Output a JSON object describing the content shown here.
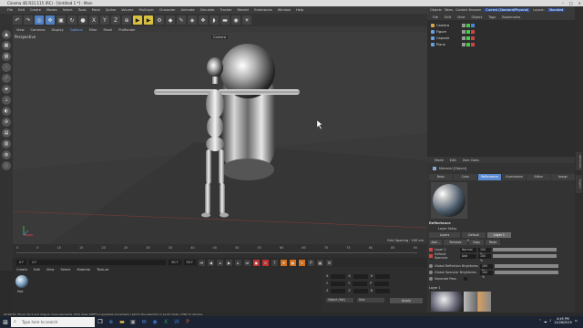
{
  "window": {
    "title": "Cinema 4D R21.115 (RC) - [Untitled 1 *] - Main",
    "controls": [
      "–",
      "□",
      "×"
    ]
  },
  "menu": [
    "File",
    "Edit",
    "Create",
    "Modes",
    "Select",
    "Tools",
    "Mesh",
    "Spline",
    "Volume",
    "MoGraph",
    "Character",
    "Animate",
    "Simulate",
    "Tracker",
    "Render",
    "Extensions",
    "Window",
    "Help"
  ],
  "toolbar": {
    "x_label": "X",
    "y_label": "Y",
    "z_label": "Z"
  },
  "viewport": {
    "menu": [
      "View",
      "Cameras",
      "Display",
      "Options",
      "Filter",
      "Panel",
      "ProRender"
    ],
    "highlight_menu": "Options",
    "label": "Perspective",
    "camera": "Camera",
    "grid_spacing": "Grid Spacing : 100 cm"
  },
  "timeline": {
    "ticks": [
      "0",
      "5",
      "10",
      "15",
      "20",
      "25",
      "30",
      "35",
      "40",
      "45",
      "50",
      "55",
      "60",
      "65",
      "70",
      "75",
      "80",
      "85",
      "90"
    ],
    "current_frame": "0 F",
    "start": "0 F",
    "end": "90 F",
    "end2": "90 F"
  },
  "material_manager": {
    "menu": [
      "Create",
      "Edit",
      "View",
      "Select",
      "Material",
      "Texture"
    ],
    "material_name": "Mat"
  },
  "coordinates": {
    "labels": [
      "X",
      "Y",
      "Z"
    ],
    "dropdown_object": "Object (Rel)",
    "dropdown_size": "Size",
    "apply": "Apply"
  },
  "statusbar": {
    "time": "00:00:00",
    "hint": "Move: Click and drag to move elements. Hold down SHIFT to quantize movement / add to the selection in point mode, CTRL to remove."
  },
  "right_panel": {
    "top_tabs": [
      "Objects",
      "Takes",
      "Content Browser",
      "Structure"
    ],
    "layout_label": "Layout:",
    "layout_value": "Standard",
    "renderer": "Current (Standard/Physical)",
    "objects_menu": [
      "File",
      "Edit",
      "View",
      "Object",
      "Tags",
      "Bookmarks"
    ],
    "objects": [
      {
        "name": "Camera",
        "color": "#d6a84a"
      },
      {
        "name": "Figure",
        "color": "#6aa0e0"
      },
      {
        "name": "Capsule",
        "color": "#6aa0e0"
      },
      {
        "name": "Plane",
        "color": "#6aa0e0"
      }
    ],
    "attr_menu": [
      "Mode",
      "Edit",
      "User Data"
    ],
    "attr_title": "Material [Object]",
    "attr_tabs": [
      "Basic",
      "Color",
      "Reflectance",
      "Illumination",
      "Editor",
      "Assign"
    ],
    "attr_selected_tab": "Reflectance",
    "section": "Reflectance",
    "layer_setup": "Layer Setup",
    "layer_buttons": [
      "Layers",
      "Default Specular",
      "Layer 1"
    ],
    "action_buttons": [
      "Add...",
      "Remove",
      "Copy",
      "Paste"
    ],
    "layer_rows": [
      {
        "name": "Layer 1",
        "mode": "Normal",
        "value": "100 %"
      },
      {
        "name": "Default Specular",
        "mode": "Add",
        "value": "100 %"
      }
    ],
    "global_reflection": {
      "label": "Global Reflection Brightness",
      "value": "100 %"
    },
    "global_specular": {
      "label": "Global Specular Brightness",
      "value": "100 %"
    },
    "separate_pass": "Separate Pass",
    "layer1_label": "Layer 1"
  },
  "side_tabs": [
    "Attributes",
    "Layers"
  ],
  "taskbar": {
    "search_placeholder": "Type here to search",
    "time": "4:45 PM",
    "date": "12/26/2019"
  }
}
